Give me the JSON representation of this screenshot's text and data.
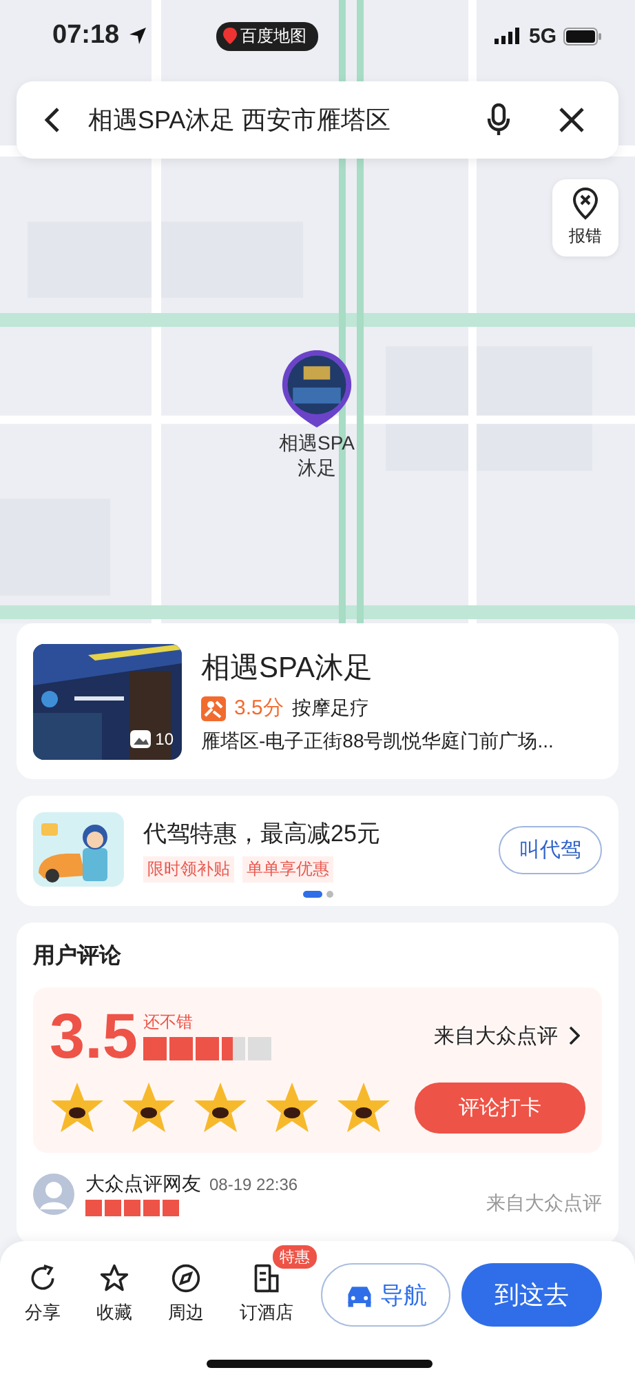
{
  "status_bar": {
    "time": "07:18",
    "back_app": "百度地图",
    "network": "5G"
  },
  "search": {
    "value": "相遇SPA沐足 西安市雁塔区"
  },
  "map": {
    "report_label": "报错",
    "pin_label_lines": [
      "相遇SPA",
      "沐足"
    ]
  },
  "place": {
    "name": "相遇SPA沐足",
    "rating": "3.5分",
    "category": "按摩足疗",
    "address": "雁塔区-电子正街88号凯悦华庭门前广场...",
    "photo_count": "10"
  },
  "promo": {
    "title": "代驾特惠，最高减25元",
    "tags": [
      "限时领补贴",
      "单单享优惠"
    ],
    "button": "叫代驾",
    "pages": [
      {
        "selected": true
      },
      {
        "selected": false
      }
    ]
  },
  "reviews": {
    "title": "用户评论",
    "score": "3.5",
    "verdict": "还不错",
    "stars": 3.5,
    "source_link": "来自大众点评",
    "button": "评论打卡",
    "items": [
      {
        "author": "大众点评网友",
        "time": "08-19 22:36",
        "stars": 5,
        "source": "来自大众点评"
      }
    ]
  },
  "toolbar": {
    "actions": [
      {
        "label": "分享",
        "kind": "share"
      },
      {
        "label": "收藏",
        "kind": "favorite"
      },
      {
        "label": "周边",
        "kind": "nearby"
      },
      {
        "label": "订酒店",
        "kind": "hotel",
        "badge": "特惠"
      }
    ],
    "navigate": "导航",
    "go": "到这去"
  }
}
